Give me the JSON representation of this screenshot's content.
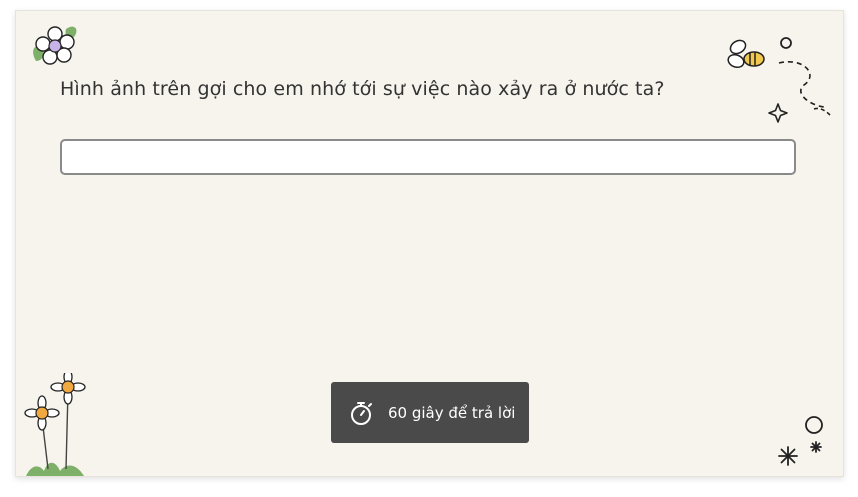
{
  "question": {
    "text": "Hình ảnh trên gợi cho em nhớ tới sự việc nào xảy ra ở nước ta?"
  },
  "answer": {
    "value": "",
    "placeholder": ""
  },
  "timer": {
    "label": "60 giây để trả lời",
    "icon": "stopwatch-icon"
  },
  "decorations": {
    "icons": [
      "flower-icon",
      "bee-icon",
      "star-icon",
      "daisy-icon",
      "sparkle-icon"
    ]
  },
  "colors": {
    "card_background": "#f6f4ec",
    "timer_background": "#4a4a4a",
    "text": "#333333"
  }
}
